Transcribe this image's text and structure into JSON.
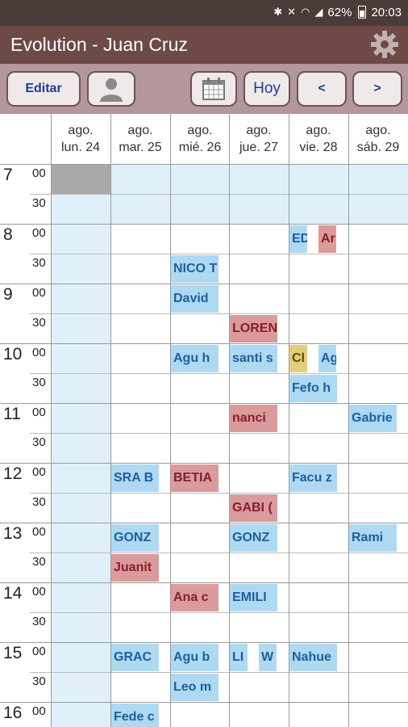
{
  "status_bar": {
    "battery": "62%",
    "time": "20:03",
    "icons": [
      "bluetooth-icon",
      "mute-icon",
      "wifi-icon",
      "signal-icon",
      "battery-icon"
    ]
  },
  "app_bar": {
    "title": "Evolution - Juan Cruz",
    "settings_icon": "gear-icon"
  },
  "toolbar": {
    "edit_label": "Editar",
    "today_label": "Hoy",
    "prev_label": "<",
    "next_label": ">",
    "profile_icon": "user-icon",
    "calendar_icon": "calendar-icon"
  },
  "colors": {
    "status_bar": "#4b3b38",
    "app_bar": "#6e4a46",
    "toolbar": "#b3979a",
    "event_blue": "#aed9f2",
    "event_red": "#d99b9b",
    "event_yellow": "#e3cf7a",
    "closed_slot": "#dff0fb"
  },
  "days": [
    {
      "month": "ago.",
      "day": "lun. 24"
    },
    {
      "month": "ago.",
      "day": "mar. 25"
    },
    {
      "month": "ago.",
      "day": "mié. 26"
    },
    {
      "month": "ago.",
      "day": "jue. 27"
    },
    {
      "month": "ago.",
      "day": "vie. 28"
    },
    {
      "month": "ago.",
      "day": "sáb. 29"
    }
  ],
  "hours": [
    "7",
    "8",
    "9",
    "10",
    "11",
    "12",
    "13",
    "14",
    "15",
    "16"
  ],
  "minutes": [
    "00",
    "30"
  ],
  "events": [
    {
      "day": 4,
      "slot": 2,
      "sub": 0,
      "text": "ED",
      "color": "blue"
    },
    {
      "day": 4,
      "slot": 2,
      "sub": 1,
      "text": "Ar",
      "color": "red"
    },
    {
      "day": 2,
      "slot": 3,
      "text": "NICO T",
      "color": "blue"
    },
    {
      "day": 2,
      "slot": 4,
      "text": "David",
      "color": "blue"
    },
    {
      "day": 3,
      "slot": 5,
      "text": "LOREN",
      "color": "red"
    },
    {
      "day": 2,
      "slot": 6,
      "text": "Agu h",
      "color": "blue"
    },
    {
      "day": 3,
      "slot": 6,
      "text": "santi s",
      "color": "blue"
    },
    {
      "day": 4,
      "slot": 6,
      "sub": 0,
      "text": "Cl",
      "color": "yellow"
    },
    {
      "day": 4,
      "slot": 6,
      "sub": 1,
      "text": "Ag",
      "color": "blue"
    },
    {
      "day": 4,
      "slot": 7,
      "text": "Fefo h",
      "color": "blue"
    },
    {
      "day": 3,
      "slot": 8,
      "text": "nanci",
      "color": "red"
    },
    {
      "day": 5,
      "slot": 8,
      "text": "Gabrie",
      "color": "blue"
    },
    {
      "day": 1,
      "slot": 10,
      "text": "SRA B",
      "color": "blue"
    },
    {
      "day": 2,
      "slot": 10,
      "text": "BETIA",
      "color": "red"
    },
    {
      "day": 4,
      "slot": 10,
      "text": "Facu z",
      "color": "blue"
    },
    {
      "day": 3,
      "slot": 11,
      "text": "GABI (",
      "color": "red"
    },
    {
      "day": 1,
      "slot": 12,
      "text": "GONZ",
      "color": "blue"
    },
    {
      "day": 3,
      "slot": 12,
      "text": "GONZ",
      "color": "blue"
    },
    {
      "day": 5,
      "slot": 12,
      "text": "Rami",
      "color": "blue"
    },
    {
      "day": 1,
      "slot": 13,
      "text": "Juanit",
      "color": "red"
    },
    {
      "day": 2,
      "slot": 14,
      "text": "Ana c",
      "color": "red"
    },
    {
      "day": 3,
      "slot": 14,
      "text": "EMILI",
      "color": "blue"
    },
    {
      "day": 1,
      "slot": 16,
      "text": "GRAC",
      "color": "blue"
    },
    {
      "day": 2,
      "slot": 16,
      "text": "Agu b",
      "color": "blue"
    },
    {
      "day": 3,
      "slot": 16,
      "sub": 0,
      "text": "LI",
      "color": "blue"
    },
    {
      "day": 3,
      "slot": 16,
      "sub": 1,
      "text": "W",
      "color": "blue"
    },
    {
      "day": 4,
      "slot": 16,
      "text": "Nahue",
      "color": "blue"
    },
    {
      "day": 2,
      "slot": 17,
      "text": "Leo m",
      "color": "blue"
    },
    {
      "day": 1,
      "slot": 18,
      "text": "Fede c",
      "color": "blue"
    }
  ]
}
